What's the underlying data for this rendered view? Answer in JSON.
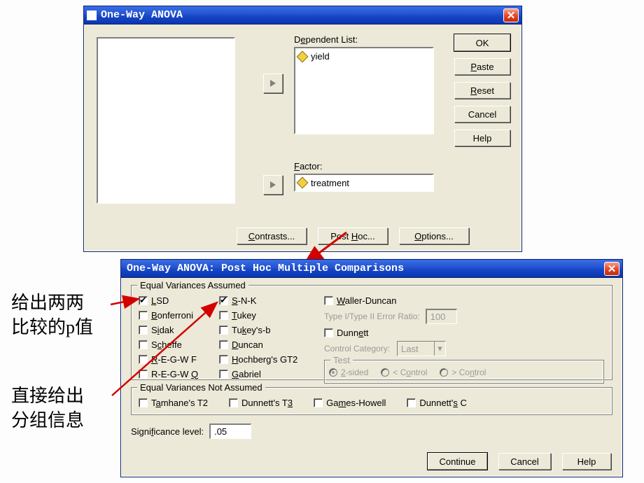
{
  "anova": {
    "title": "One-Way ANOVA",
    "dep_label_html": "D<u>e</u>pendent List:",
    "dep_item": "yield",
    "factor_label_html": "<u>F</u>actor:",
    "factor_item": "treatment",
    "contrasts_html": "<u>C</u>ontrasts...",
    "posthoc_html": "Post <u>H</u>oc...",
    "options_html": "<u>O</u>ptions...",
    "ok": "OK",
    "paste_html": "<u>P</u>aste",
    "reset_html": "<u>R</u>eset",
    "cancel": "Cancel",
    "help": "Help"
  },
  "posthoc": {
    "title": "One-Way ANOVA: Post Hoc Multiple Comparisons",
    "g1_title": "Equal Variances Assumed",
    "lsd_html": "<u>L</u>SD",
    "bonf_html": "<u>B</u>onferroni",
    "sidak_html": "S<u>i</u>dak",
    "scheffe_html": "S<u>c</u>heffe",
    "regwf_html": "<u>R</u>-E-G-W F",
    "regwq_html": "R-E-G-W <u>Q</u>",
    "snk_html": "<u>S</u>-N-K",
    "tukey_html": "<u>T</u>ukey",
    "tukeysb_html": "Tu<u>k</u>ey's-b",
    "duncan_html": "<u>D</u>uncan",
    "hoch_html": "<u>H</u>ochberg's GT2",
    "gabriel_html": "<u>G</u>abriel",
    "waller_html": "<u>W</u>aller-Duncan",
    "ratio_label_html": "Type I/Type II Error Ratio:",
    "ratio_value": "100",
    "dunnett_html": "Dunn<u>e</u>tt",
    "ctrlcat_label": "Control Category:",
    "ctrlcat_value": "Last",
    "test_title": "Test",
    "twosided_html": "<u>2</u>-sided",
    "ltcontrol_html": "< C<u>o</u>ntrol",
    "gtcontrol_html": "> Co<u>n</u>trol",
    "g2_title": "Equal Variances Not Assumed",
    "tamhane_html": "T<u>a</u>mhane's T2",
    "dunnettt3_html": "Dunnett's T<u>3</u>",
    "games_html": "Ga<u>m</u>es-Howell",
    "dunnettc_html": "Dunnett'<u>s</u> C",
    "sig_label_html": "Signi<u>f</u>icance level:",
    "sig_value": ".05",
    "continue": "Continue",
    "cancel": "Cancel",
    "help": "Help"
  },
  "annotations": {
    "a1": "给出两两\n比较的p值",
    "a2": "直接给出\n分组信息"
  }
}
